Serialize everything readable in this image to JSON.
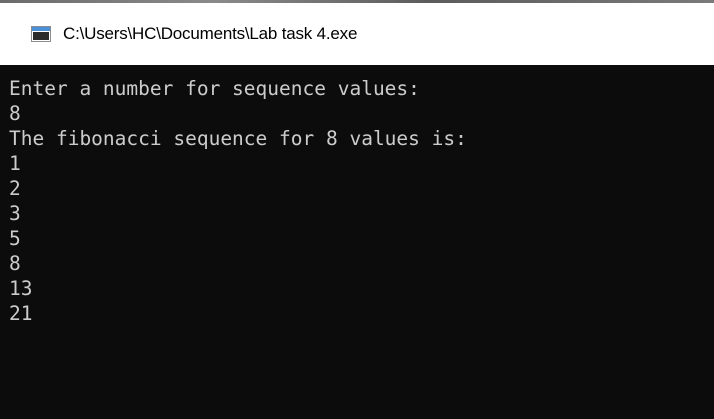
{
  "window": {
    "title": "C:\\Users\\HC\\Documents\\Lab task 4.exe",
    "icon": "console-app-icon"
  },
  "console": {
    "background": "#0c0c0c",
    "foreground": "#cccccc",
    "lines": [
      "Enter a number for sequence values:",
      "8",
      "The fibonacci sequence for 8 values is:",
      "1",
      "2",
      "3",
      "5",
      "8",
      "13",
      "21"
    ]
  }
}
